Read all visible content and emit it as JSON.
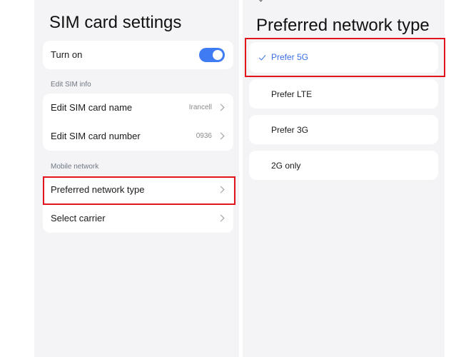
{
  "sim_settings": {
    "title": "SIM card settings",
    "turn_on": {
      "label": "Turn on",
      "enabled": true
    },
    "edit_section": "Edit SIM info",
    "edit_items": [
      {
        "label": "Edit SIM card name",
        "value": "Irancell"
      },
      {
        "label": "Edit SIM card number",
        "value": "0936"
      }
    ],
    "mobile_section": "Mobile network",
    "mobile_items": [
      {
        "label": "Preferred network type"
      },
      {
        "label": "Select carrier"
      }
    ]
  },
  "network_type": {
    "title": "Preferred network type",
    "options": [
      {
        "label": "Prefer 5G",
        "selected": true
      },
      {
        "label": "Prefer LTE",
        "selected": false
      },
      {
        "label": "Prefer 3G",
        "selected": false
      },
      {
        "label": "2G only",
        "selected": false
      }
    ]
  },
  "colors": {
    "accent": "#3f7cf4",
    "highlight": "#e0141a",
    "background": "#f4f4f6"
  }
}
